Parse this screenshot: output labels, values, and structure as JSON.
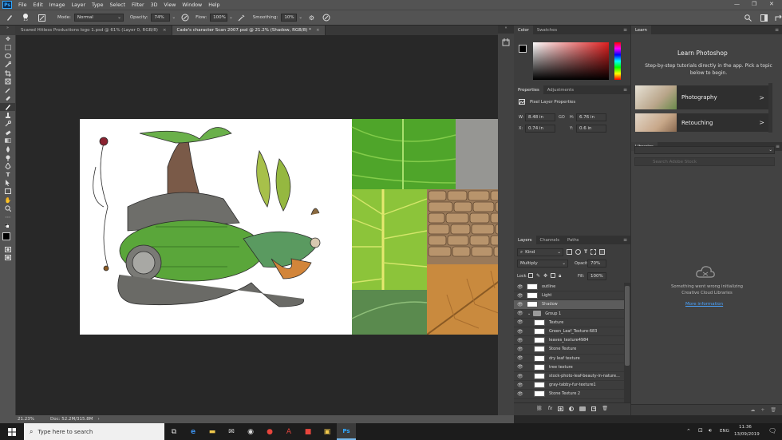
{
  "menubar": {
    "app_icon": "Ps",
    "items": [
      "File",
      "Edit",
      "Image",
      "Layer",
      "Type",
      "Select",
      "Filter",
      "3D",
      "View",
      "Window",
      "Help"
    ],
    "minimize": "—",
    "maximize": "❐",
    "close": "✕"
  },
  "options": {
    "brush_size": "15",
    "mode_label": "Mode:",
    "mode_value": "Normal",
    "opacity_label": "Opacity:",
    "opacity_value": "74%",
    "flow_label": "Flow:",
    "flow_value": "100%",
    "smoothing_label": "Smoothing:",
    "smoothing_value": "10%"
  },
  "tabs": [
    {
      "label": "Scared Hitless Productions logo 1.psd @ 61% (Layer 0, RGB/8)",
      "close": "×"
    },
    {
      "label": "Cade's character Scan 2007.psd @ 21.2% (Shadow, RGB/8) *",
      "close": "×"
    }
  ],
  "status": {
    "zoom": "21.23%",
    "doc": "Doc: 52.2M/315.8M"
  },
  "color_panel": {
    "tabs": [
      "Color",
      "Swatches"
    ]
  },
  "properties_panel": {
    "tabs": [
      "Properties",
      "Adjustments"
    ],
    "title": "Pixel Layer Properties",
    "w_label": "W:",
    "w": "8.48 in",
    "h_label": "H:",
    "h": "6.76 in",
    "x_label": "X:",
    "x": "0.74 in",
    "y_label": "Y:",
    "y": "0.6 in",
    "link": "GO"
  },
  "layers_panel": {
    "tabs": [
      "Layers",
      "Channels",
      "Paths"
    ],
    "kind": "Kind",
    "blend": "Multiply",
    "opacity_label": "Opacity:",
    "opacity": "70%",
    "lock_label": "Lock:",
    "fill_label": "Fill:",
    "fill": "100%",
    "layers": [
      {
        "name": "outline",
        "type": "layer",
        "selected": false
      },
      {
        "name": "Light",
        "type": "layer",
        "selected": false
      },
      {
        "name": "Shadow",
        "type": "layer",
        "selected": true
      },
      {
        "name": "Group 1",
        "type": "group",
        "selected": false
      },
      {
        "name": "Texture",
        "type": "layer",
        "selected": false
      },
      {
        "name": "Green_Leaf_Texture-683",
        "type": "layer",
        "selected": false
      },
      {
        "name": "leaves_texture4984",
        "type": "layer",
        "selected": false
      },
      {
        "name": "Stone Texture",
        "type": "layer",
        "selected": false
      },
      {
        "name": "dry leaf texture",
        "type": "layer",
        "selected": false
      },
      {
        "name": "tree texture",
        "type": "layer",
        "selected": false
      },
      {
        "name": "stock-photo-leaf-beauty-in-nature...",
        "type": "layer",
        "selected": false
      },
      {
        "name": "gray-tabby-fur-texture1",
        "type": "layer",
        "selected": false
      },
      {
        "name": "Stone Texture 2",
        "type": "layer",
        "selected": false
      }
    ],
    "footer_icons": [
      "link-icon",
      "fx-icon",
      "mask-icon",
      "adjustment-icon",
      "folder-icon",
      "new-layer-icon",
      "trash-icon"
    ]
  },
  "learn_panel": {
    "header": "Learn",
    "title": "Learn Photoshop",
    "description": "Step-by-step tutorials directly in the app. Pick a topic below to begin.",
    "topics": [
      {
        "label": "Photography",
        "arrow": ">"
      },
      {
        "label": "Retouching",
        "arrow": ">"
      }
    ]
  },
  "libraries_panel": {
    "header": "Libraries",
    "search_placeholder": "Search Adobe Stock",
    "error": "Something went wrong initializing Creative Cloud Libraries",
    "link": "More information"
  },
  "taskbar": {
    "search_placeholder": "Type here to search",
    "lang": "ENG",
    "time": "11:36",
    "date": "13/09/2019"
  },
  "colors": {
    "ps_blue": "#31a8ff",
    "hue_red": "#e02020",
    "link_blue": "#4aa3ff",
    "selected_layer": "#5c5c5c"
  }
}
